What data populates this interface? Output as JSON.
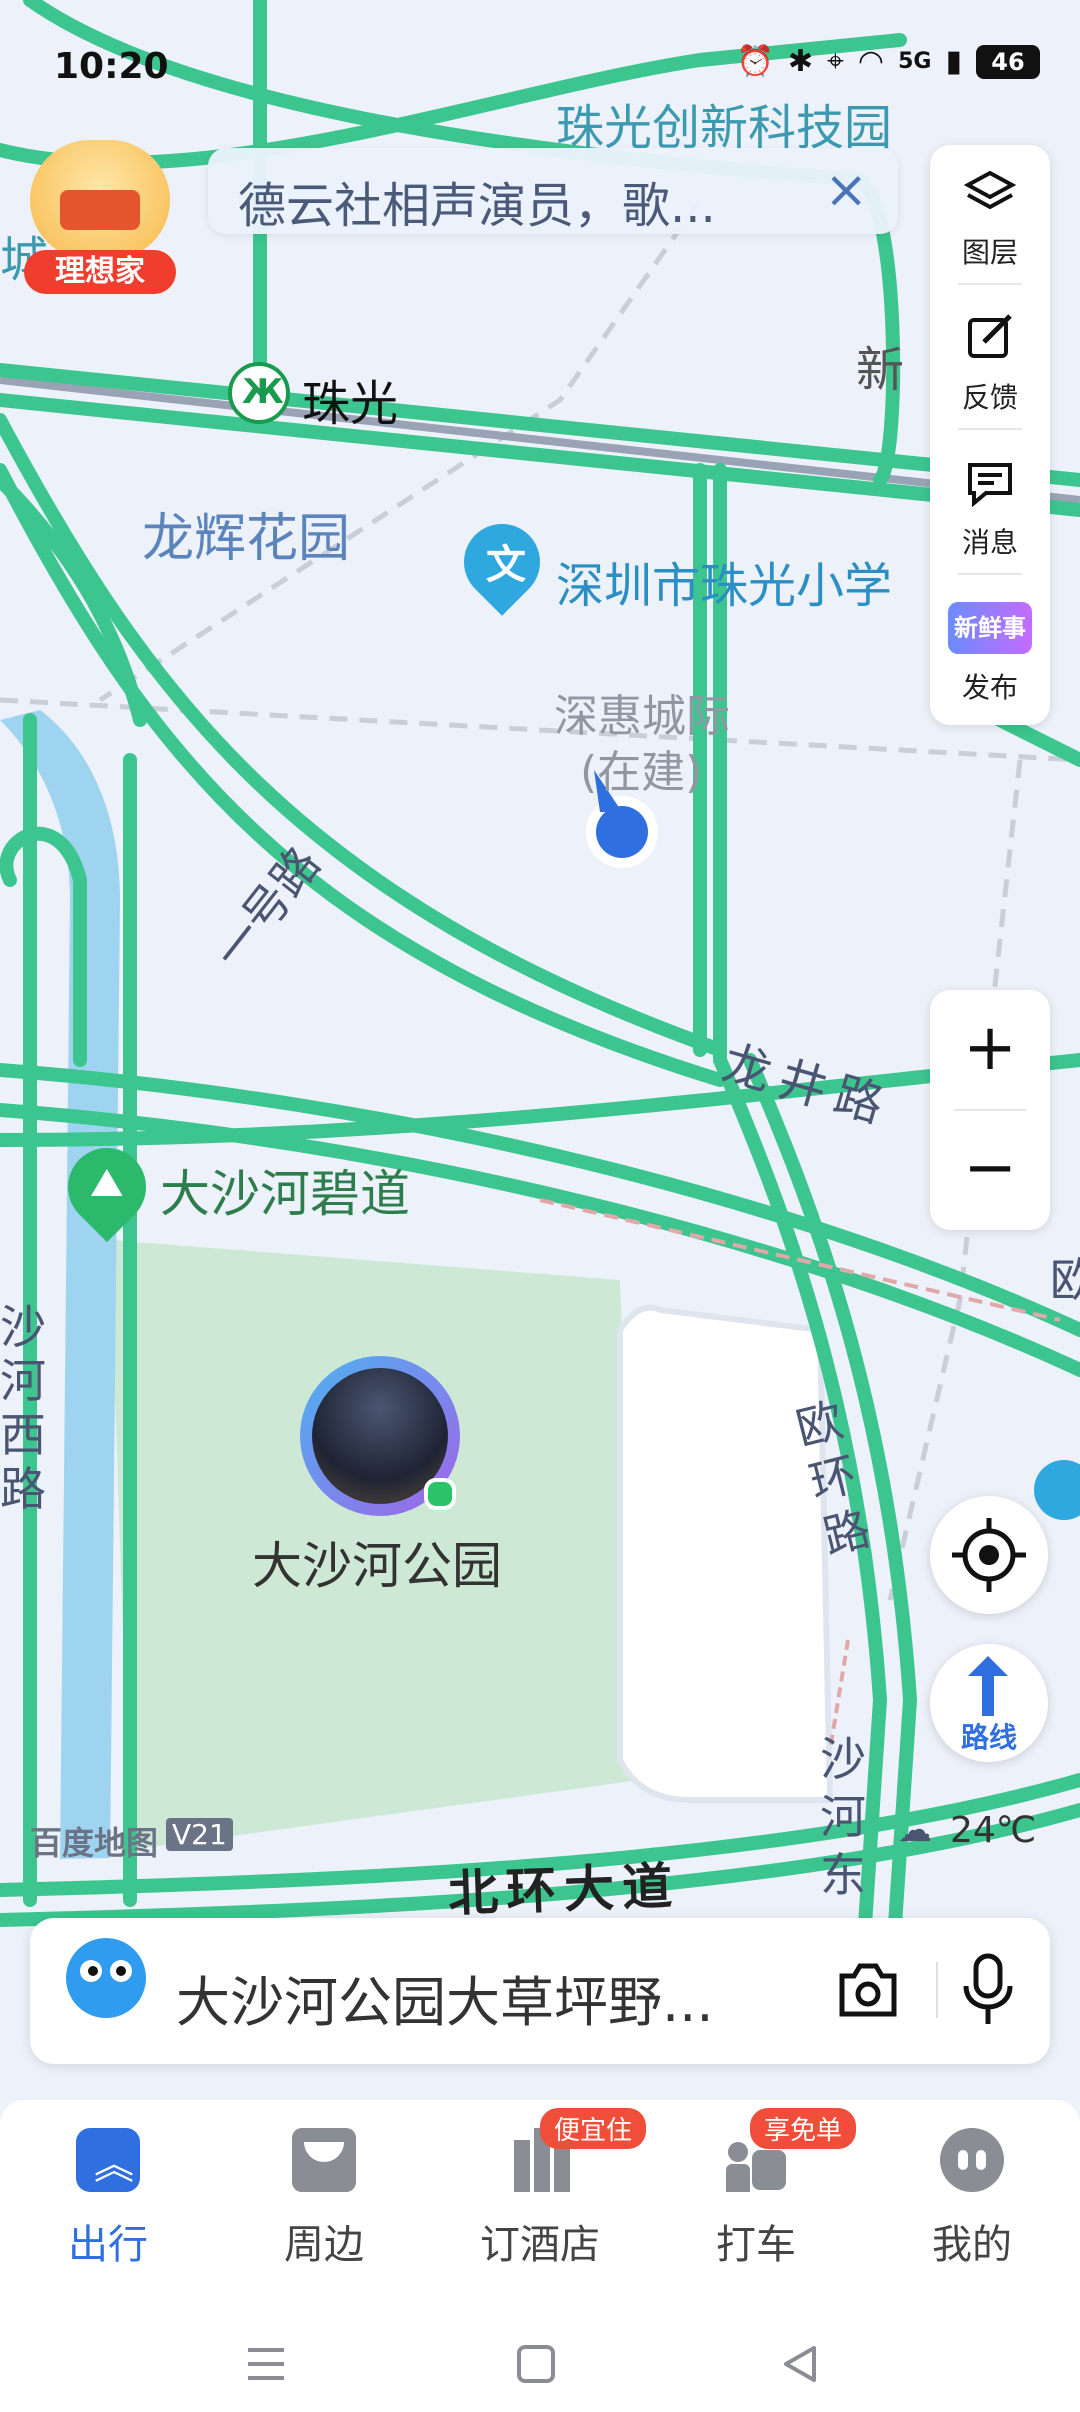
{
  "status_bar": {
    "time": "10:20",
    "network": "5G",
    "battery": "46"
  },
  "top_search": {
    "text": "德云社相声演员，歌...",
    "close": "×"
  },
  "promo": {
    "label": "理想家"
  },
  "tools": [
    {
      "icon": "layers-icon",
      "label": "图层"
    },
    {
      "icon": "feedback-icon",
      "label": "反馈"
    },
    {
      "icon": "message-icon",
      "label": "消息"
    },
    {
      "icon": "news-icon",
      "label": "发布",
      "logo_text": "新鲜事"
    }
  ],
  "zoom": {
    "in": "+",
    "out": "−"
  },
  "map_labels": {
    "park_tech": "珠光创新科技园",
    "xin": "新",
    "metro_station": "珠光",
    "longhui": "龙辉花园",
    "school": "深圳市珠光小学",
    "railway": "深惠城际",
    "railway_sub": "(在建)",
    "road_yihao": "一号路",
    "road_longjing": "龙井路",
    "greenway": "大沙河碧道",
    "west_road": "沙河西路",
    "park": "大沙河公园",
    "road_ouhuan": "欧环路",
    "road_shahe_east": "沙河东",
    "road_beihuan": "北环大道",
    "brand": "百度地图",
    "brand_version": "V21",
    "weather": "24℃",
    "edge_cheng": "城",
    "edge_ou": "欧"
  },
  "route_button": {
    "label": "路线"
  },
  "search_bar": {
    "text": "大沙河公园大草坪野..."
  },
  "bottom_nav": [
    {
      "icon": "travel-icon",
      "label": "出行",
      "active": true,
      "badge": ""
    },
    {
      "icon": "nearby-icon",
      "label": "周边",
      "active": false,
      "badge": ""
    },
    {
      "icon": "hotel-icon",
      "label": "订酒店",
      "active": false,
      "badge": "便宜住"
    },
    {
      "icon": "taxi-icon",
      "label": "打车",
      "active": false,
      "badge": "享免单"
    },
    {
      "icon": "profile-icon",
      "label": "我的",
      "active": false,
      "badge": ""
    }
  ],
  "colors": {
    "road": "#3cc58f",
    "accent": "#2f6fe0",
    "water": "#9ed4f0",
    "park": "#cde9d6",
    "badge": "#f04e3a"
  }
}
